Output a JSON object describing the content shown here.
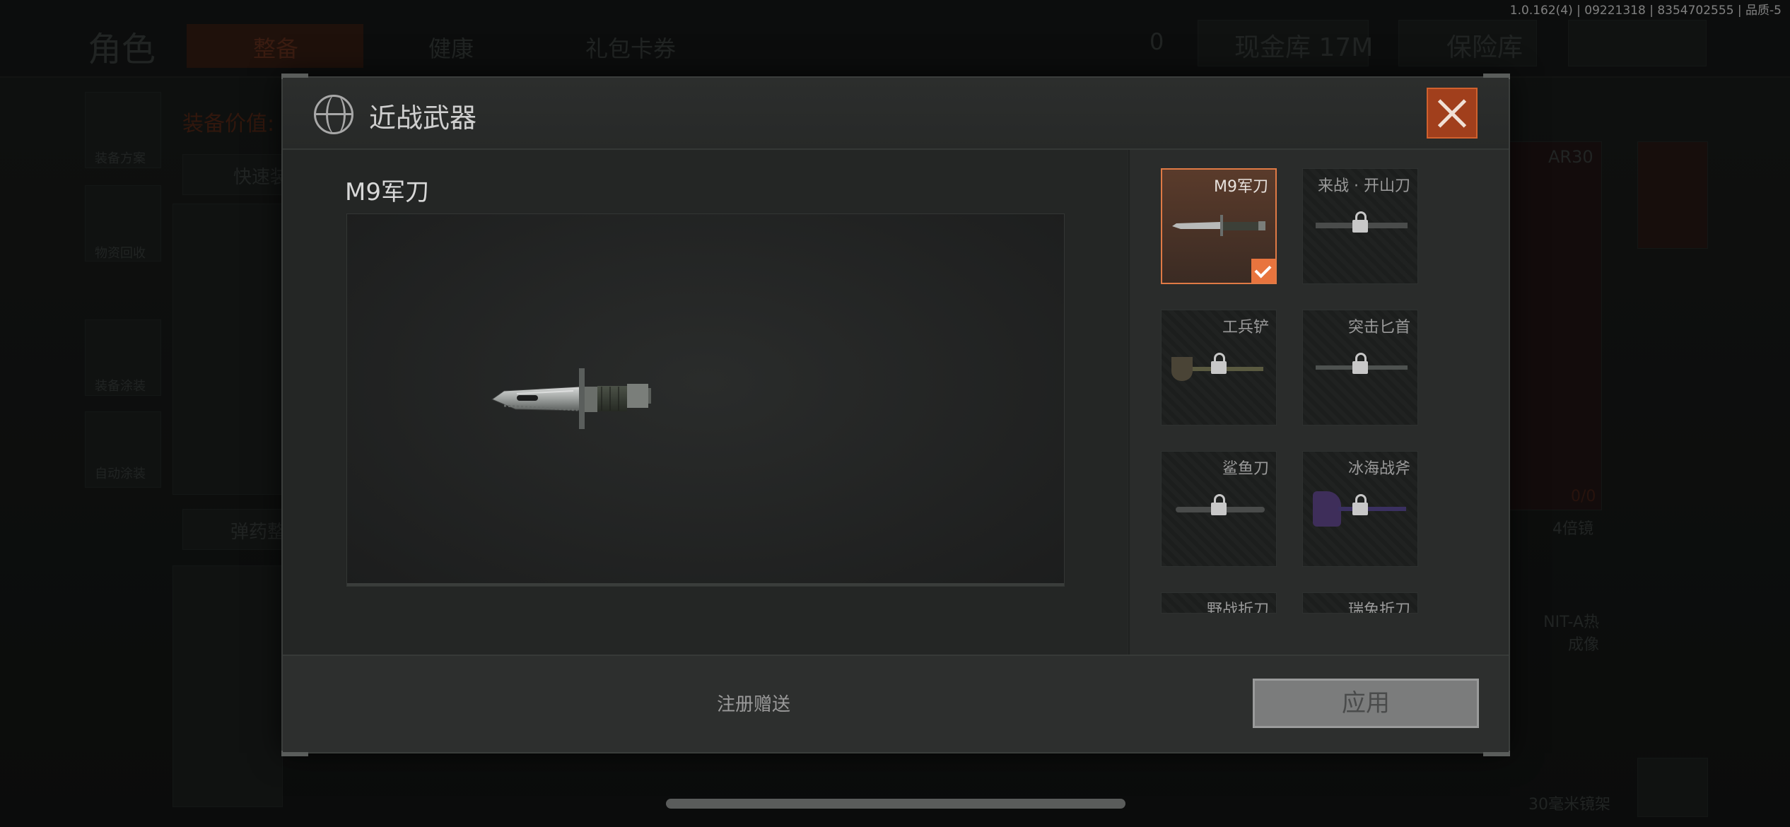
{
  "build_info": "1.0.162(4) | 09221318 | 8354702555 | 品质-5",
  "background": {
    "page_title": "角色",
    "tabs": [
      "整备",
      "健康",
      "礼包卡券"
    ],
    "currency_value": "0",
    "cash_vault": "现金库 17M",
    "safe": "保险库",
    "equip_value_label": "装备价值:",
    "quick_equip": "快速装",
    "ammo_label": "弹药整",
    "left_menu": [
      "装备方案",
      "物资回收",
      "装备涂装",
      "自动涂装"
    ],
    "right_labels": {
      "ar": "AR30",
      "ammo_count": "0/0",
      "scope": "4倍镜",
      "thermal": "NIT-A热成像",
      "mount": "30毫米镜架"
    }
  },
  "modal": {
    "title": "近战武器",
    "selected_weapon": "M9军刀",
    "gift_text": "注册赠送",
    "apply_label": "应用",
    "items": [
      {
        "name": "M9军刀",
        "selected": true,
        "locked": false
      },
      {
        "name": "来战 · 开山刀",
        "selected": false,
        "locked": true
      },
      {
        "name": "工兵铲",
        "selected": false,
        "locked": true
      },
      {
        "name": "突击匕首",
        "selected": false,
        "locked": true
      },
      {
        "name": "鲨鱼刀",
        "selected": false,
        "locked": true
      },
      {
        "name": "冰海战斧",
        "selected": false,
        "locked": true
      },
      {
        "name": "野战折刀",
        "selected": false,
        "locked": true
      },
      {
        "name": "瑞兔折刀",
        "selected": false,
        "locked": true
      }
    ]
  },
  "colors": {
    "accent": "#e8743e",
    "close_bg": "#a13f1c",
    "apply_bg": "#7b7c7c"
  },
  "icons": [
    "globe-icon",
    "close-icon",
    "lock-icon",
    "check-icon",
    "knife-icon"
  ]
}
